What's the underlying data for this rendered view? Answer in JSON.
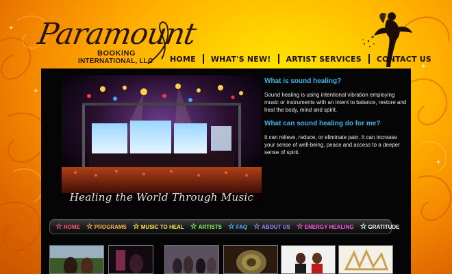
{
  "logo": {
    "script_text": "Paramount",
    "line1": "BOOKING",
    "line2": "INTERNATIONAL, LLC"
  },
  "top_nav": [
    {
      "label": "HOME"
    },
    {
      "label": "WHAT'S NEW!"
    },
    {
      "label": "ARTIST SERVICES"
    },
    {
      "label": "CONTACT US"
    }
  ],
  "hero": {
    "caption": "Healing the World Through Music"
  },
  "content": {
    "q1": "What is sound healing?",
    "a1": "Sound healing is using intentional vibration employing music or instruments  with an intent to balance, restore and heal the body, mind and spirit.",
    "q2": "What can sound healing do for me?",
    "a2": "It can relieve, reduce, or eliminate pain. It can increase your sense of well-being, peace and access to a deeper sense of spirit."
  },
  "sub_nav": [
    {
      "label": "HOME",
      "color": "#ff5a7a"
    },
    {
      "label": "PROGRAMS",
      "color": "#ffb84a"
    },
    {
      "label": "MUSIC TO HEAL",
      "color": "#ffe84a"
    },
    {
      "label": "ARTISTS",
      "color": "#8cff6a"
    },
    {
      "label": "FAQ",
      "color": "#56b6ff"
    },
    {
      "label": "ABOUT US",
      "color": "#9a8cff"
    },
    {
      "label": "ENERGY HEALING",
      "color": "#ff5ae6"
    },
    {
      "label": "GRATITUDE",
      "color": "#ffffff"
    }
  ],
  "colors": {
    "heading": "#3fb2e8",
    "panel": "#050505",
    "nav_text": "#1c1007"
  }
}
